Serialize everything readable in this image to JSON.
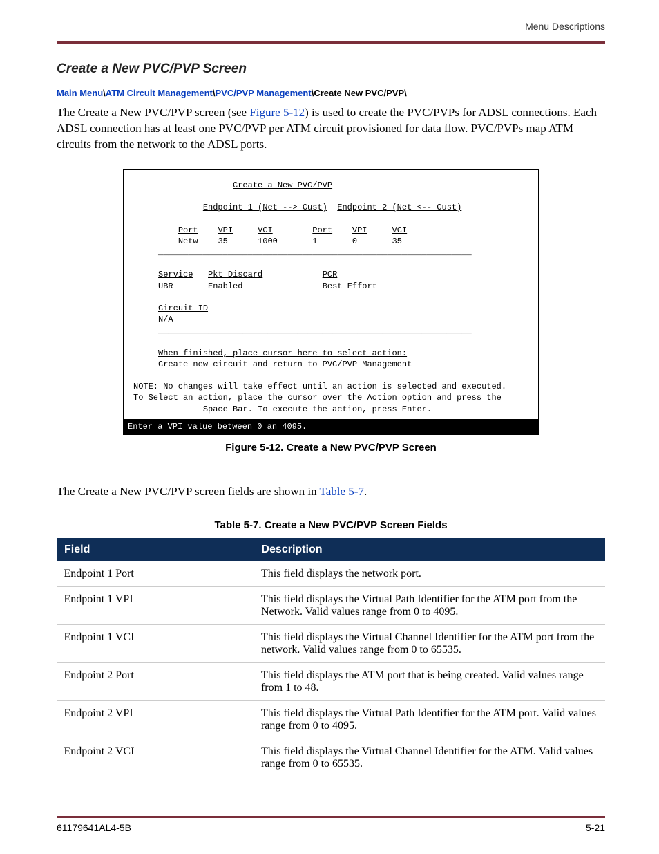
{
  "header": {
    "right_label": "Menu Descriptions"
  },
  "section_title": "Create a New PVC/PVP Screen",
  "breadcrumb": {
    "seg1": "Main Menu",
    "seg2": "ATM Circuit Management",
    "seg3": "PVC/PVP Management",
    "tail": "Create New PVC/PVP\\"
  },
  "body_paragraph": {
    "p1a": "The Create a New PVC/PVP screen (see ",
    "fig_ref": "Figure 5-12",
    "p1b": ") is used to create the PVC/PVPs for ADSL connections. Each ADSL connection has at least one PVC/PVP per ATM circuit provisioned for data flow. PVC/PVPs map ATM circuits from the network to the ADSL ports."
  },
  "terminal": {
    "title": "Create a New PVC/PVP",
    "endpoint1_label": "Endpoint 1 (Net --> Cust)",
    "endpoint2_label": "Endpoint 2 (Net <-- Cust)",
    "cols": {
      "port": "Port",
      "vpi": "VPI",
      "vci": "VCI"
    },
    "row1": {
      "e1_port": "Netw",
      "e1_vpi": "35",
      "e1_vci": "1000",
      "e2_port": "1",
      "e2_vpi": "0",
      "e2_vci": "35"
    },
    "service_label": "Service",
    "pkt_discard_label": "Pkt Discard",
    "pcr_label": "PCR",
    "service_val": "UBR",
    "pkt_discard_val": "Enabled",
    "pcr_val": "Best Effort",
    "circuit_id_label": "Circuit ID",
    "circuit_id_val": "N/A",
    "action_prompt": "When finished, place cursor here to select action:",
    "action_line": "Create new circuit and return to PVC/PVP Management",
    "note1": "NOTE: No changes will take effect until an action is selected and executed.",
    "note2": "To Select an action, place the cursor over the Action option and press the",
    "note3": "Space Bar. To execute the action, press Enter.",
    "status": "Enter a VPI value between 0 an 4095."
  },
  "figure_caption": "Figure 5-12.  Create a New PVC/PVP Screen",
  "post_fig": {
    "a": "The Create a New PVC/PVP screen fields are shown in ",
    "ref": "Table 5-7",
    "b": "."
  },
  "table_caption": "Table 5-7.  Create a New PVC/PVP Screen Fields",
  "table_headers": {
    "field": "Field",
    "desc": "Description"
  },
  "table_rows": [
    {
      "field": "Endpoint 1 Port",
      "desc": "This field displays the network port."
    },
    {
      "field": "Endpoint 1 VPI",
      "desc": "This field displays the Virtual Path Identifier for the ATM port from the Network. Valid values range from 0 to 4095."
    },
    {
      "field": "Endpoint 1 VCI",
      "desc": "This field displays the Virtual Channel Identifier for the ATM port from the network. Valid values range from 0 to 65535."
    },
    {
      "field": "Endpoint 2 Port",
      "desc": "This field displays the ATM port that is being created. Valid values range from 1 to 48."
    },
    {
      "field": "Endpoint 2 VPI",
      "desc": "This field displays the Virtual Path Identifier for the ATM port. Valid values range from 0 to 4095."
    },
    {
      "field": "Endpoint 2 VCI",
      "desc": "This field displays the Virtual Channel Identifier for the ATM. Valid values range from 0 to 65535."
    }
  ],
  "footer": {
    "left": "61179641AL4-5B",
    "right": "5-21"
  }
}
